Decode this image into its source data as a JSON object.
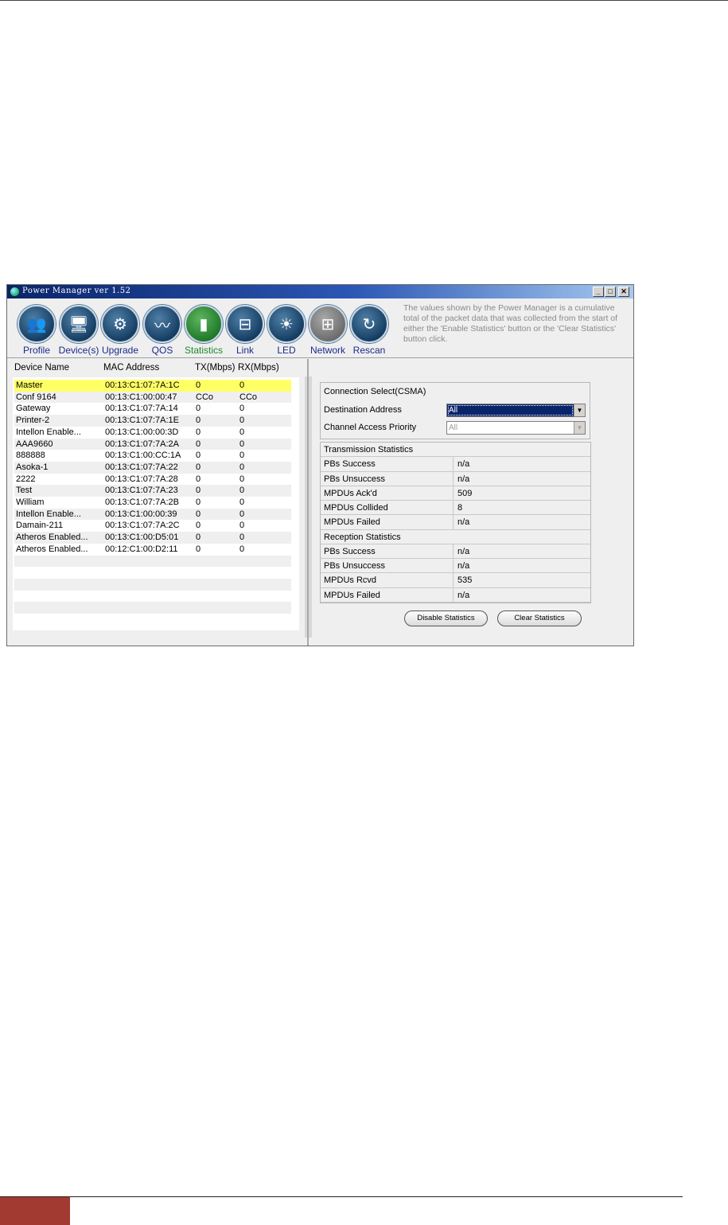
{
  "window": {
    "title": "Power Manager ver 1.52",
    "controls": {
      "minimize": "_",
      "maximize": "□",
      "close": "✕"
    }
  },
  "toolbar": {
    "tools": [
      {
        "label": "Profile",
        "icon": "people-icon",
        "glyph": "👥",
        "state": "normal"
      },
      {
        "label": "Device(s)",
        "icon": "devices-icon",
        "glyph": "🖥",
        "state": "normal"
      },
      {
        "label": "Upgrade",
        "icon": "upgrade-icon",
        "glyph": "⚙",
        "state": "normal"
      },
      {
        "label": "QOS",
        "icon": "waveform-icon",
        "glyph": "〰",
        "state": "normal"
      },
      {
        "label": "Statistics",
        "icon": "bar-chart-icon",
        "glyph": "▮",
        "state": "active"
      },
      {
        "label": "Link",
        "icon": "link-icon",
        "glyph": "⊟",
        "state": "normal"
      },
      {
        "label": "LED",
        "icon": "led-icon",
        "glyph": "☀",
        "state": "normal"
      },
      {
        "label": "Network",
        "icon": "network-icon",
        "glyph": "⊞",
        "state": "disabled"
      },
      {
        "label": "Rescan",
        "icon": "rescan-icon",
        "glyph": "↻",
        "state": "normal"
      }
    ],
    "info": "The values shown by the Power Manager is a cumulative total of the packet data that was collected from the start of either the 'Enable Statistics' button or the 'Clear Statistics' button click."
  },
  "device_list": {
    "headers": [
      "Device Name",
      "MAC Address",
      "TX(Mbps)",
      "RX(Mbps)"
    ],
    "rows": [
      [
        "Master",
        "00:13:C1:07:7A:1C",
        "0",
        "0"
      ],
      [
        "Conf 9164",
        "00:13:C1:00:00:47",
        "CCo",
        "CCo"
      ],
      [
        "Gateway",
        "00:13:C1:07:7A:14",
        "0",
        "0"
      ],
      [
        "Printer-2",
        "00:13:C1:07:7A:1E",
        "0",
        "0"
      ],
      [
        "Intellon Enable...",
        "00:13:C1:00:00:3D",
        "0",
        "0"
      ],
      [
        "AAA9660",
        "00:13:C1:07:7A:2A",
        "0",
        "0"
      ],
      [
        "888888",
        "00:13:C1:00:CC:1A",
        "0",
        "0"
      ],
      [
        "Asoka-1",
        "00:13:C1:07:7A:22",
        "0",
        "0"
      ],
      [
        "2222",
        "00:13:C1:07:7A:28",
        "0",
        "0"
      ],
      [
        "Test",
        "00:13:C1:07:7A:23",
        "0",
        "0"
      ],
      [
        "William",
        "00:13:C1:07:7A:2B",
        "0",
        "0"
      ],
      [
        "Intellon Enable...",
        "00:13:C1:00:00:39",
        "0",
        "0"
      ],
      [
        "Damain-211",
        "00:13:C1:07:7A:2C",
        "0",
        "0"
      ],
      [
        "Atheros Enabled...",
        "00:13:C1:00:D5:01",
        "0",
        "0"
      ],
      [
        "Atheros Enabled...",
        "00:12:C1:00:D2:11",
        "0",
        "0"
      ]
    ]
  },
  "connection": {
    "title": "Connection Select(CSMA)",
    "destination_label": "Destination Address",
    "destination_value": "All",
    "priority_label": "Channel Access Priority",
    "priority_value": "All"
  },
  "stats": [
    {
      "key": "Transmission Statistics",
      "value": null,
      "header": true
    },
    {
      "key": "PBs Success",
      "value": "n/a"
    },
    {
      "key": "PBs Unsuccess",
      "value": "n/a"
    },
    {
      "key": "MPDUs Ack'd",
      "value": "509"
    },
    {
      "key": "MPDUs Collided",
      "value": "8"
    },
    {
      "key": "MPDUs Failed",
      "value": "n/a"
    },
    {
      "key": "Reception Statistics",
      "value": null,
      "header": true
    },
    {
      "key": "PBs Success",
      "value": "n/a"
    },
    {
      "key": "PBs Unsuccess",
      "value": "n/a"
    },
    {
      "key": "MPDUs Rcvd",
      "value": "535"
    },
    {
      "key": "MPDUs Failed",
      "value": "n/a"
    }
  ],
  "buttons": {
    "disable": "Disable Statistics",
    "clear": "Clear Statistics"
  },
  "colors": {
    "selected_row": "#ffff66",
    "footer_accent": "#a33a32",
    "title_bar": "#0a246a"
  }
}
